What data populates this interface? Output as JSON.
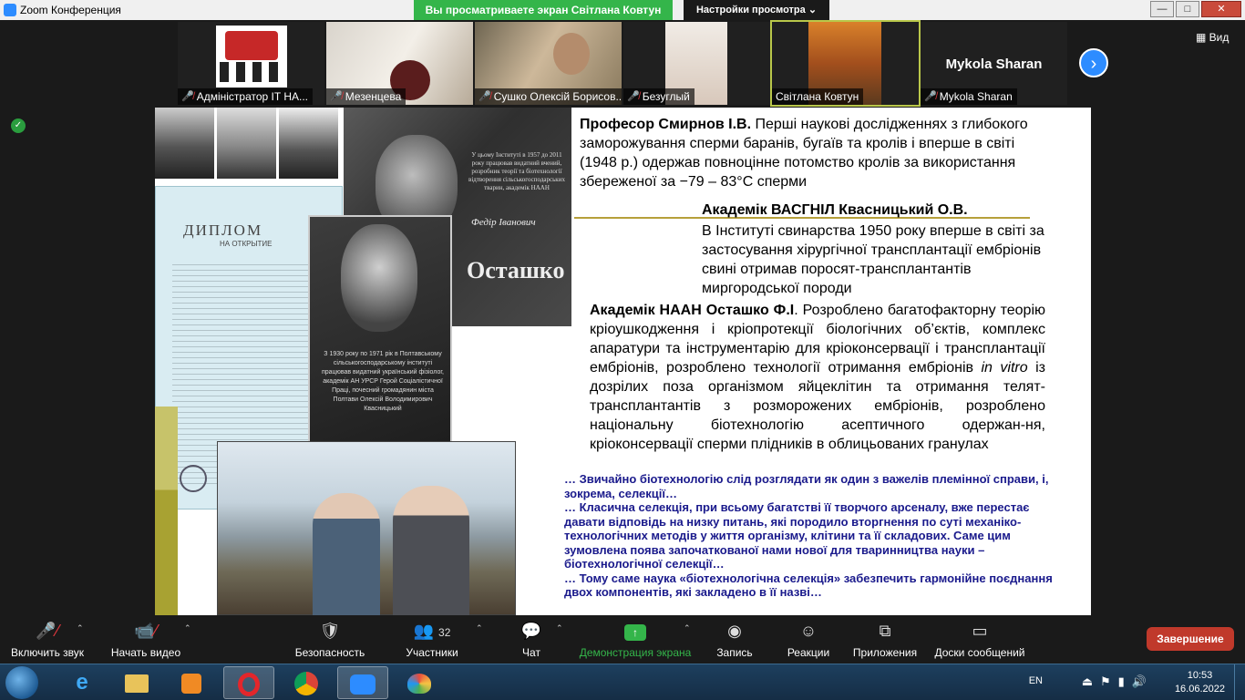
{
  "window": {
    "title": "Zoom Конференция",
    "share_banner": "Вы просматриваете экран Світлана Ковтун",
    "view_settings": "Настройки просмотра",
    "view_settings_icon": "chevron-down-icon",
    "view_label": "Вид"
  },
  "participants": [
    {
      "name": "Адміністратор IT НА...",
      "muted": true
    },
    {
      "name": "Мезенцева",
      "muted": true
    },
    {
      "name": "Сушко Олексій Борисов...",
      "muted": true
    },
    {
      "name": "Безуглый",
      "muted": true
    },
    {
      "name": "Світлана Ковтун",
      "muted": false,
      "active": true
    },
    {
      "name": "Mykola Sharan",
      "muted": true,
      "avatar_text": "Mykola Sharan"
    }
  ],
  "slide": {
    "plaque1_text": "У цьому Інституті в 1957 до 2011 року працював видатний вчений, розробник теорії та біотехнології відтворення сільськогосподарських тварин, академік НААН",
    "plaque1_first_names": "Федір Іванович",
    "plaque1_surname": "Осташко",
    "plaque2_text": "З 1930 року по 1971 рік в Полтавському сільськогосподарському інституті працював видатний український фізіолог, академік АН УРСР Герой Соціалістичної Праці, почесний громадянин міста Полтави Олексій Володимирович Квасницький",
    "diploma_title": "ДИПЛОМ",
    "diploma_subtitle": "НА ОТКРЫТИЕ",
    "block1_bold": "Професор Смирнов І.В.",
    "block1_text": " Перші наукові дослідженнях з глибокого заморожування сперми баранів, бугаїв та кролів і вперше в світі (1948 р.) одержав повноцінне потомство кролів за використання збереженої за −79 – 83°С сперми",
    "block2_bold": "Академік ВАСГНІЛ Квасницький О.В.",
    "block2_text": "В Інституті свинарства 1950 року вперше в світі за застосування хірургічної трансплантації ембріонів свині отримав поросят-трансплантантів миргородської породи",
    "block3_bold": "Академік НААН Осташко Ф.І",
    "block3_text_a": ". Розроблено багатофакторну теорію кріоушкодження і кріопротекції біологічних об’єктів, комплекс апаратури та інструментарію для кріоконсервації і трансплантації ембріонів, розроблено технології отримання ембріонів ",
    "block3_italic": "in vitro",
    "block3_text_b": " із дозрілих поза організмом яйцеклітин та отримання телят-трансплантантів з розморожених ембріонів, розроблено національну біотехнологію асептичного одержан-ня, кріоконсервації сперми плідників в облицьованих гранулах",
    "quote1": "… Звичайно біотехнологію слід розглядати як один з важелів племінної справи, і, зокрема, селекції…",
    "quote2": "… Класична селекція, при всьому багатстві її творчого арсеналу, вже перестає давати відповідь на низку питань, які породило вторгнення по суті механіко-технологічних методів у життя організму, клітини та її складових. Саме цим зумовлена поява започаткованої нами нової для тваринництва науки – біотехнологічної селекції…",
    "quote3": "… Тому саме наука «біотехнологічна селекція» забезпечить гармонійне поєднання двох компонентів, які закладено в її назві…"
  },
  "controls": {
    "audio": "Включить звук",
    "video": "Начать видео",
    "security": "Безопасность",
    "participants": "Участники",
    "participants_count": "32",
    "chat": "Чат",
    "share": "Демонстрация экрана",
    "record": "Запись",
    "reactions": "Реакции",
    "apps": "Приложения",
    "whiteboards": "Доски сообщений",
    "end": "Завершение"
  },
  "taskbar": {
    "lang": "EN",
    "time": "10:53",
    "date": "16.06.2022",
    "apps": [
      "ie-icon",
      "explorer-icon",
      "media-player-icon",
      "opera-icon",
      "chrome-icon",
      "zoom-icon",
      "paint-icon"
    ]
  }
}
